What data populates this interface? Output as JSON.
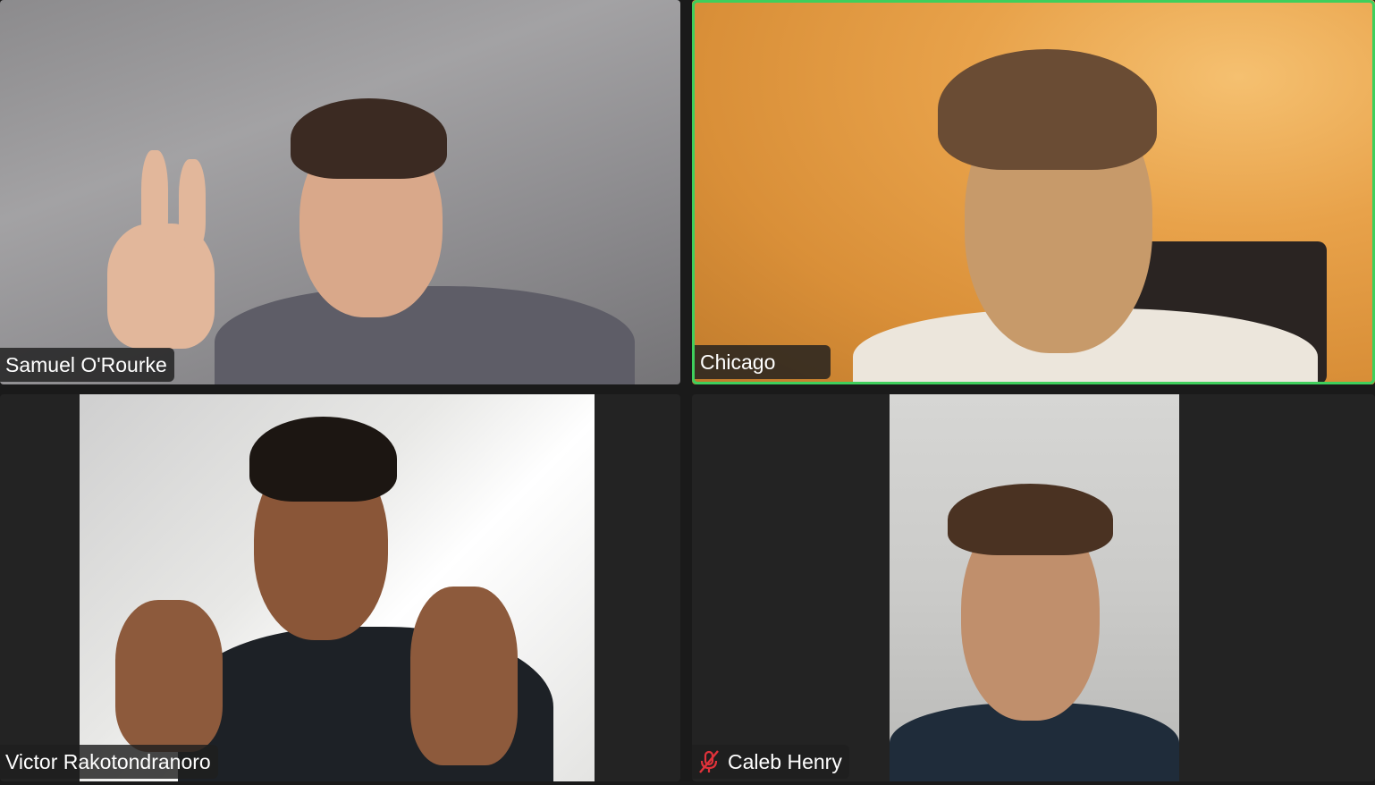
{
  "participants": [
    {
      "name": "Samuel O'Rourke",
      "muted": false,
      "active_speaker": false
    },
    {
      "name": "Chicago",
      "muted": false,
      "active_speaker": true
    },
    {
      "name": "Victor Rakotondranoro",
      "muted": false,
      "active_speaker": false
    },
    {
      "name": "Caleb Henry",
      "muted": true,
      "active_speaker": false
    }
  ],
  "colors": {
    "active_speaker_border": "#3fcf5c",
    "muted_icon": "#e0323a",
    "tile_background": "#232323"
  }
}
